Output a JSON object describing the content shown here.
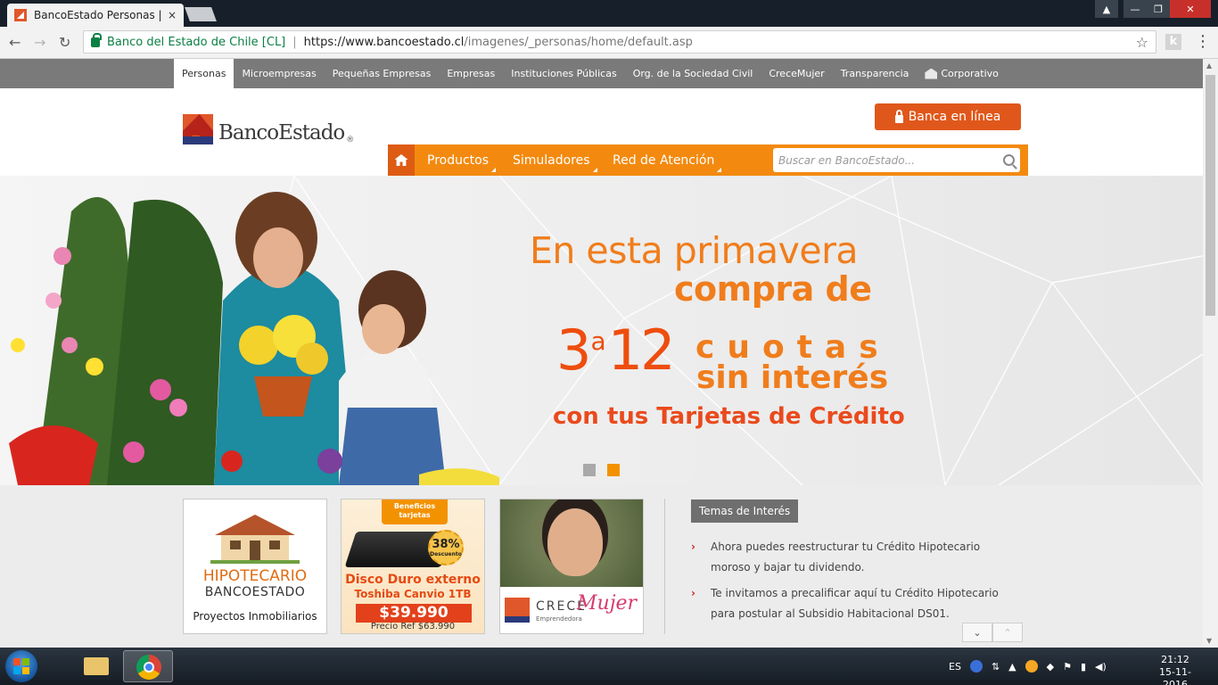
{
  "browser": {
    "tab_title": "BancoEstado Personas | Ba",
    "tab_close": "×",
    "window_controls": [
      "▲",
      "—",
      "❐",
      "✕"
    ],
    "nav": {
      "back": "←",
      "forward": "→",
      "reload": "↻"
    },
    "secure_label": "Banco del Estado de Chile [CL]",
    "separator": "|",
    "url_host": "https://www.bancoestado.cl",
    "url_path": "/imagenes/_personas/home/default.asp",
    "star": "☆",
    "extension_label": "k",
    "menu": "⋮"
  },
  "topnav": {
    "items": [
      {
        "label": "Personas",
        "active": true
      },
      {
        "label": "Microempresas"
      },
      {
        "label": "Pequeñas Empresas"
      },
      {
        "label": "Empresas"
      },
      {
        "label": "Instituciones Públicas"
      },
      {
        "label": "Org. de la Sociedad Civil"
      },
      {
        "label": "CreceMujer"
      },
      {
        "label": "Transparencia"
      },
      {
        "label": "Corporativo"
      }
    ]
  },
  "header": {
    "logo_text": "BancoEstado",
    "logo_reg": "®",
    "banca_button": "Banca en línea",
    "menu": [
      {
        "label": "Productos"
      },
      {
        "label": "Simuladores"
      },
      {
        "label": "Red de Atención"
      }
    ],
    "search_placeholder": "Buscar en BancoEstado..."
  },
  "hero": {
    "line1": "En esta primavera",
    "line2": "compra de",
    "num_from": "3",
    "num_a": "a",
    "num_to": "12",
    "cuotas": "cuotas",
    "sin_interes": "sin interés",
    "line4": "con tus Tarjetas de Crédito",
    "slides_total": 2,
    "slide_active": 2
  },
  "cards": {
    "hipotecario": {
      "title": "HIPOTECARIO",
      "subtitle": "BANCOESTADO",
      "caption": "Proyectos Inmobiliarios"
    },
    "disco": {
      "badge_top": "Beneficios tarjetas",
      "discount": "38%",
      "discount_label": "Descuento",
      "line1": "Disco Duro externo",
      "line2": "Toshiba Canvio 1TB",
      "price": "$39.990",
      "price_ref": "Precio Ref $63.990"
    },
    "crece": {
      "word1": "CRECE",
      "word2": "Emprendedora",
      "word3": "Mujer"
    }
  },
  "temas": {
    "heading": "Temas de Interés",
    "items": [
      "Ahora puedes reestructurar tu Crédito Hipotecario moroso y bajar tu dividendo.",
      "Te invitamos a precalificar aquí tu Crédito Hipotecario para postular al Subsidio Habitacional DS01."
    ],
    "bullet": "›",
    "down_btn": "⌄",
    "up_btn": "⌃"
  },
  "taskbar": {
    "lang": "ES",
    "clock_time": "21:12",
    "clock_date": "15-11-2016"
  }
}
